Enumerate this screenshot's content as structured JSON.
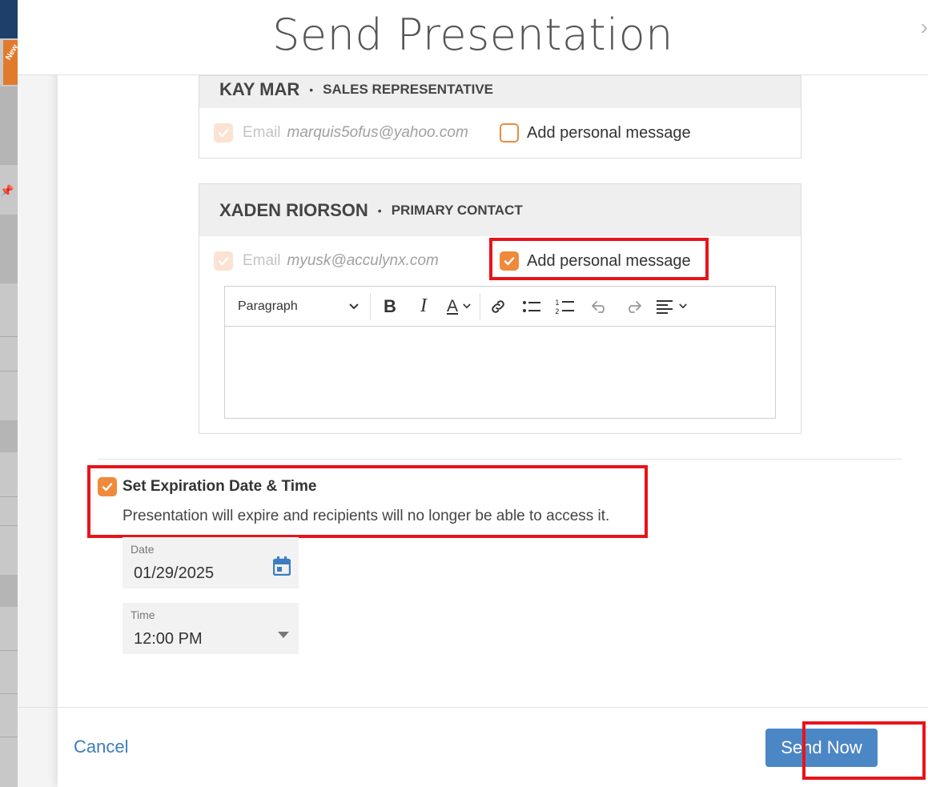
{
  "background": {
    "badge_text": "New"
  },
  "modal": {
    "title": "Send Presentation",
    "close_icon": "chevron-right-icon"
  },
  "recipients": [
    {
      "name": "KAY MAR",
      "role": "SALES REPRESENTATIVE",
      "email_label": "Email",
      "email": "marquis5ofus@yahoo.com",
      "email_checked": true,
      "personal_message_label": "Add personal message",
      "personal_message_checked": false
    },
    {
      "name": "XADEN RIORSON",
      "role": "PRIMARY CONTACT",
      "email_label": "Email",
      "email": "myusk@acculynx.com",
      "email_checked": true,
      "personal_message_label": "Add personal message",
      "personal_message_checked": true
    }
  ],
  "editor": {
    "paragraph_label": "Paragraph",
    "body": ""
  },
  "expiration": {
    "checked": true,
    "title": "Set Expiration Date & Time",
    "description": "Presentation will expire and recipients will no longer be able to access it.",
    "date_label": "Date",
    "date_value": "01/29/2025",
    "time_label": "Time",
    "time_value": "12:00 PM"
  },
  "footer": {
    "cancel_label": "Cancel",
    "send_label": "Send Now"
  },
  "colors": {
    "accent_orange": "#ef8a3c",
    "primary_blue": "#4c87c5",
    "link_blue": "#3d7dbf",
    "highlight_red": "#e8141b"
  }
}
